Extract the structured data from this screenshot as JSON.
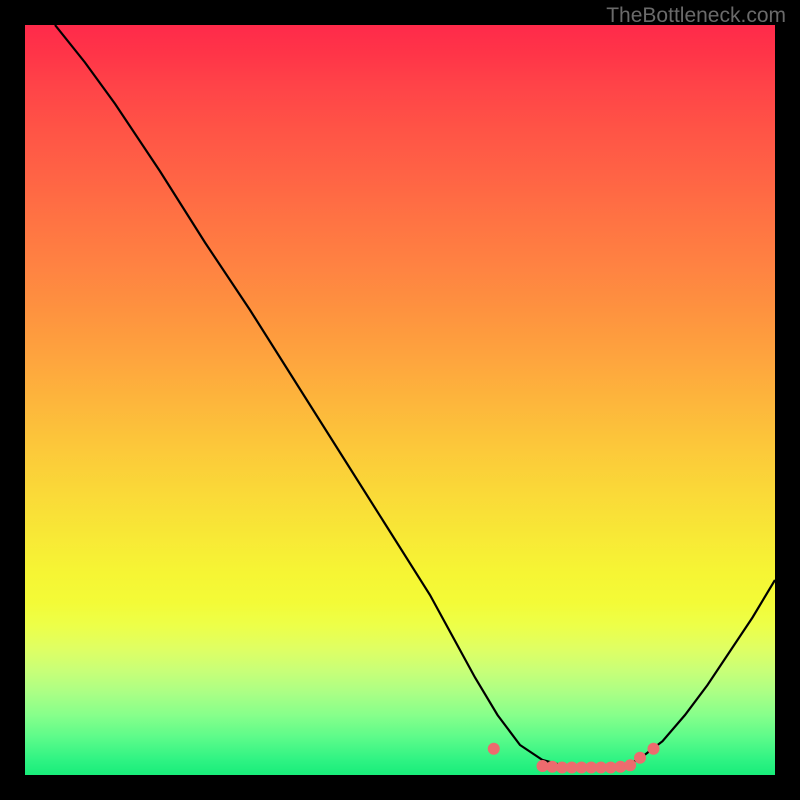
{
  "watermark": "TheBottleneck.com",
  "chart_data": {
    "type": "line",
    "title": "",
    "xlabel": "",
    "ylabel": "",
    "xlim": [
      0,
      100
    ],
    "ylim": [
      0,
      100
    ],
    "series": [
      {
        "name": "bottleneck-curve",
        "x": [
          4,
          8,
          12,
          18,
          24,
          30,
          36,
          42,
          48,
          54,
          60,
          63,
          66,
          69,
          72,
          74,
          76,
          78,
          80,
          82,
          85,
          88,
          91,
          94,
          97,
          100
        ],
        "y": [
          100,
          95,
          89.5,
          80.5,
          71,
          62,
          52.5,
          43,
          33.5,
          24,
          13,
          8,
          4,
          2,
          1.2,
          1.0,
          1.0,
          1.0,
          1.2,
          2.2,
          4.5,
          8,
          12,
          16.5,
          21,
          26
        ],
        "stroke": "#000000",
        "stroke_width": 2
      }
    ],
    "markers": [
      {
        "name": "optimal-range-dots",
        "x": [
          62.5,
          69,
          70.3,
          71.6,
          72.9,
          74.2,
          75.5,
          76.8,
          78.1,
          79.4,
          80.7,
          82,
          83.8
        ],
        "y": [
          3.5,
          1.2,
          1.1,
          1.0,
          1.0,
          1.0,
          1.0,
          1.0,
          1.0,
          1.1,
          1.3,
          2.3,
          3.5
        ],
        "color": "#ed6b6e",
        "size": 6
      }
    ],
    "gradient_colors": {
      "top": "#ff2a4a",
      "mid_upper": "#fea33e",
      "mid_lower": "#f6f534",
      "bottom": "#18ed7a"
    }
  }
}
